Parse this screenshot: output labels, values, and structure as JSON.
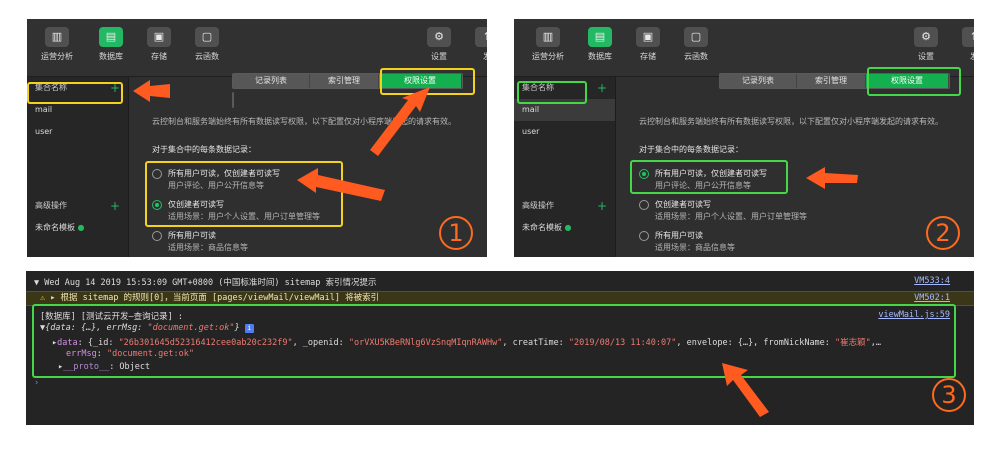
{
  "toolbar": {
    "items": [
      "运营分析",
      "数据库",
      "存储",
      "云函数"
    ],
    "settings": "设置",
    "extra": "发"
  },
  "sidebar": {
    "collections_header": "集合名称",
    "collections": [
      "mail",
      "user"
    ],
    "advanced_header": "高级操作",
    "templates": [
      "未命名模板"
    ]
  },
  "tabs": [
    "记录列表",
    "索引管理",
    "权限设置"
  ],
  "notice": "云控制台和服务端始终有所有数据读写权限，以下配置仅对小程序端发起的请求有效。",
  "section_title": "对于集合中的每条数据记录：",
  "options": [
    {
      "title": "所有用户可读，仅创建者可读写",
      "desc": "用户评论、用户公开信息等"
    },
    {
      "title": "仅创建者可读写",
      "desc": "适用场景：用户个人设置、用户订单管理等"
    },
    {
      "title": "所有用户可读",
      "desc": "适用场景：商品信息等"
    }
  ],
  "badges": [
    "1",
    "2",
    "3"
  ],
  "console": {
    "group_header": "Wed Aug 14 2019 15:53:09 GMT+0800 (中国标准时间) sitemap 索引情况提示",
    "group_link": "VM533:4",
    "warning": "根据 sitemap 的规则[0]，当前页面 [pages/viewMail/viewMail] 将被索引",
    "warning_link": "VM502:1",
    "log_label": "[数据库] [测试云开发—查询记录] :",
    "log_link": "viewMail.js:59",
    "summary_keys": "{data: {…}, errMsg: ",
    "summary_msg": "\"document.get:ok\"",
    "summary_end": "}",
    "data_line_key": "data",
    "data_line_a": ": {_id: ",
    "data_line_id": "\"26b301645d52316412cee0ab20c232f9\"",
    "data_line_b": ", _openid: ",
    "data_line_openid": "\"orVXU5KBeRNlg6VzSnqMIqnRAWHw\"",
    "data_line_c": ", creatTime: ",
    "data_line_time": "\"2019/08/13 11:40:07\"",
    "data_line_d": ", envelope: {…}, fromNickName: ",
    "data_line_name": "\"崔志颖\"",
    "data_line_e": ",…",
    "errmsg_key": "errMsg",
    "errmsg_val": "\"document.get:ok\"",
    "proto_key": "__proto__",
    "proto_val": ": Object",
    "prompt": "›"
  },
  "colors": {
    "accent": "#14b04f",
    "highlight_yellow": "#f2d21c",
    "highlight_green": "#45d649",
    "arrow": "#ff5a1f"
  }
}
